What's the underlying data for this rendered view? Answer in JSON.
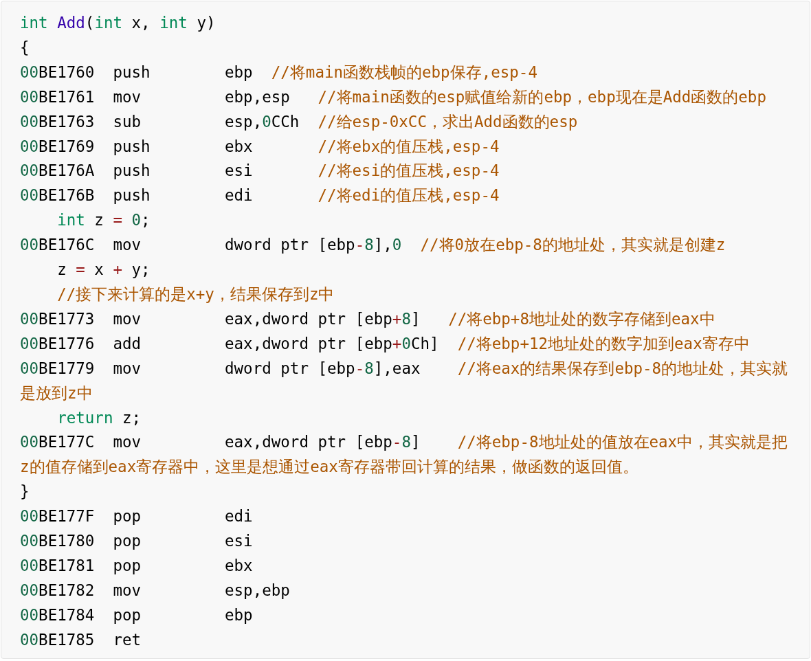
{
  "code_block": {
    "lines": [
      {
        "tokens": [
          {
            "kind": "kw",
            "text": "int"
          },
          {
            "kind": "fn",
            "text": " Add"
          },
          {
            "kind": "plain",
            "text": "("
          },
          {
            "kind": "kw",
            "text": "int"
          },
          {
            "kind": "plain",
            "text": " x, "
          },
          {
            "kind": "kw",
            "text": "int"
          },
          {
            "kind": "plain",
            "text": " y)"
          }
        ]
      },
      {
        "tokens": [
          {
            "kind": "plain",
            "text": "{"
          }
        ]
      },
      {
        "tokens": [
          {
            "kind": "num",
            "text": "00"
          },
          {
            "kind": "plain",
            "text": "BE1760  push        ebp  "
          },
          {
            "kind": "cm",
            "text": "//将main函数栈帧的ebp保存,esp-4"
          }
        ]
      },
      {
        "tokens": [
          {
            "kind": "num",
            "text": "00"
          },
          {
            "kind": "plain",
            "text": "BE1761  mov         ebp,esp   "
          },
          {
            "kind": "cm",
            "text": "//将main函数的esp赋值给新的ebp，ebp现在是Add函数的ebp"
          }
        ]
      },
      {
        "tokens": [
          {
            "kind": "num",
            "text": "00"
          },
          {
            "kind": "plain",
            "text": "BE1763  sub         esp,"
          },
          {
            "kind": "num",
            "text": "0"
          },
          {
            "kind": "plain",
            "text": "CCh  "
          },
          {
            "kind": "cm",
            "text": "//给esp-0xCC，求出Add函数的esp"
          }
        ]
      },
      {
        "tokens": [
          {
            "kind": "num",
            "text": "00"
          },
          {
            "kind": "plain",
            "text": "BE1769  push        ebx       "
          },
          {
            "kind": "cm",
            "text": "//将ebx的值压栈,esp-4"
          }
        ]
      },
      {
        "tokens": [
          {
            "kind": "num",
            "text": "00"
          },
          {
            "kind": "plain",
            "text": "BE176A  push        esi       "
          },
          {
            "kind": "cm",
            "text": "//将esi的值压栈,esp-4"
          }
        ]
      },
      {
        "tokens": [
          {
            "kind": "num",
            "text": "00"
          },
          {
            "kind": "plain",
            "text": "BE176B  push        edi       "
          },
          {
            "kind": "cm",
            "text": "//将edi的值压栈,esp-4"
          }
        ]
      },
      {
        "tokens": [
          {
            "kind": "kw",
            "text": "    int"
          },
          {
            "kind": "plain",
            "text": " z "
          },
          {
            "kind": "op",
            "text": "= "
          },
          {
            "kind": "num",
            "text": "0"
          },
          {
            "kind": "plain",
            "text": ";"
          }
        ]
      },
      {
        "tokens": [
          {
            "kind": "num",
            "text": "00"
          },
          {
            "kind": "plain",
            "text": "BE176C  mov         dword ptr [ebp"
          },
          {
            "kind": "op",
            "text": "-"
          },
          {
            "kind": "num",
            "text": "8"
          },
          {
            "kind": "plain",
            "text": "],"
          },
          {
            "kind": "num",
            "text": "0"
          },
          {
            "kind": "cm",
            "text": "  //将0放在ebp-8的地址处，其实就是创建z"
          }
        ]
      },
      {
        "tokens": [
          {
            "kind": "plain",
            "text": "    z "
          },
          {
            "kind": "op",
            "text": "="
          },
          {
            "kind": "plain",
            "text": " x "
          },
          {
            "kind": "op",
            "text": "+"
          },
          {
            "kind": "plain",
            "text": " y;"
          }
        ]
      },
      {
        "tokens": [
          {
            "kind": "cm",
            "text": "    //接下来计算的是x+y，结果保存到z中"
          }
        ]
      },
      {
        "tokens": [
          {
            "kind": "num",
            "text": "00"
          },
          {
            "kind": "plain",
            "text": "BE1773  mov         eax,dword ptr [ebp"
          },
          {
            "kind": "op",
            "text": "+"
          },
          {
            "kind": "num",
            "text": "8"
          },
          {
            "kind": "plain",
            "text": "]   "
          },
          {
            "kind": "cm",
            "text": "//将ebp+8地址处的数字存储到eax中"
          }
        ]
      },
      {
        "tokens": [
          {
            "kind": "num",
            "text": "00"
          },
          {
            "kind": "plain",
            "text": "BE1776  add         eax,dword ptr [ebp"
          },
          {
            "kind": "op",
            "text": "+"
          },
          {
            "kind": "num",
            "text": "0"
          },
          {
            "kind": "plain",
            "text": "Ch]  "
          },
          {
            "kind": "cm",
            "text": "//将ebp+12地址处的数字加到eax寄存中"
          }
        ]
      },
      {
        "tokens": [
          {
            "kind": "num",
            "text": "00"
          },
          {
            "kind": "plain",
            "text": "BE1779  mov         dword ptr [ebp"
          },
          {
            "kind": "op",
            "text": "-"
          },
          {
            "kind": "num",
            "text": "8"
          },
          {
            "kind": "plain",
            "text": "],eax    "
          },
          {
            "kind": "cm",
            "text": "//将eax的结果保存到ebp-8的地址处，其实就是放到z中"
          }
        ]
      },
      {
        "tokens": [
          {
            "kind": "kw",
            "text": "    return"
          },
          {
            "kind": "plain",
            "text": " z;"
          }
        ]
      },
      {
        "tokens": [
          {
            "kind": "num",
            "text": "00"
          },
          {
            "kind": "plain",
            "text": "BE177C  mov         eax,dword ptr [ebp"
          },
          {
            "kind": "op",
            "text": "-"
          },
          {
            "kind": "num",
            "text": "8"
          },
          {
            "kind": "plain",
            "text": "]    "
          },
          {
            "kind": "cm",
            "text": "//将ebp-8地址处的值放在eax中，其实就是把z的值存储到eax寄存器中，这里是想通过eax寄存器带回计算的结果，做函数的返回值。"
          }
        ]
      },
      {
        "tokens": [
          {
            "kind": "plain",
            "text": "}"
          }
        ]
      },
      {
        "tokens": [
          {
            "kind": "num",
            "text": "00"
          },
          {
            "kind": "plain",
            "text": "BE177F  pop         edi"
          }
        ]
      },
      {
        "tokens": [
          {
            "kind": "num",
            "text": "00"
          },
          {
            "kind": "plain",
            "text": "BE1780  pop         esi"
          }
        ]
      },
      {
        "tokens": [
          {
            "kind": "num",
            "text": "00"
          },
          {
            "kind": "plain",
            "text": "BE1781  pop         ebx"
          }
        ]
      },
      {
        "tokens": [
          {
            "kind": "num",
            "text": "00"
          },
          {
            "kind": "plain",
            "text": "BE1782  mov         esp,ebp"
          }
        ]
      },
      {
        "tokens": [
          {
            "kind": "num",
            "text": "00"
          },
          {
            "kind": "plain",
            "text": "BE1784  pop         ebp"
          }
        ]
      },
      {
        "tokens": [
          {
            "kind": "num",
            "text": "00"
          },
          {
            "kind": "plain",
            "text": "BE1785  ret"
          }
        ]
      }
    ]
  }
}
